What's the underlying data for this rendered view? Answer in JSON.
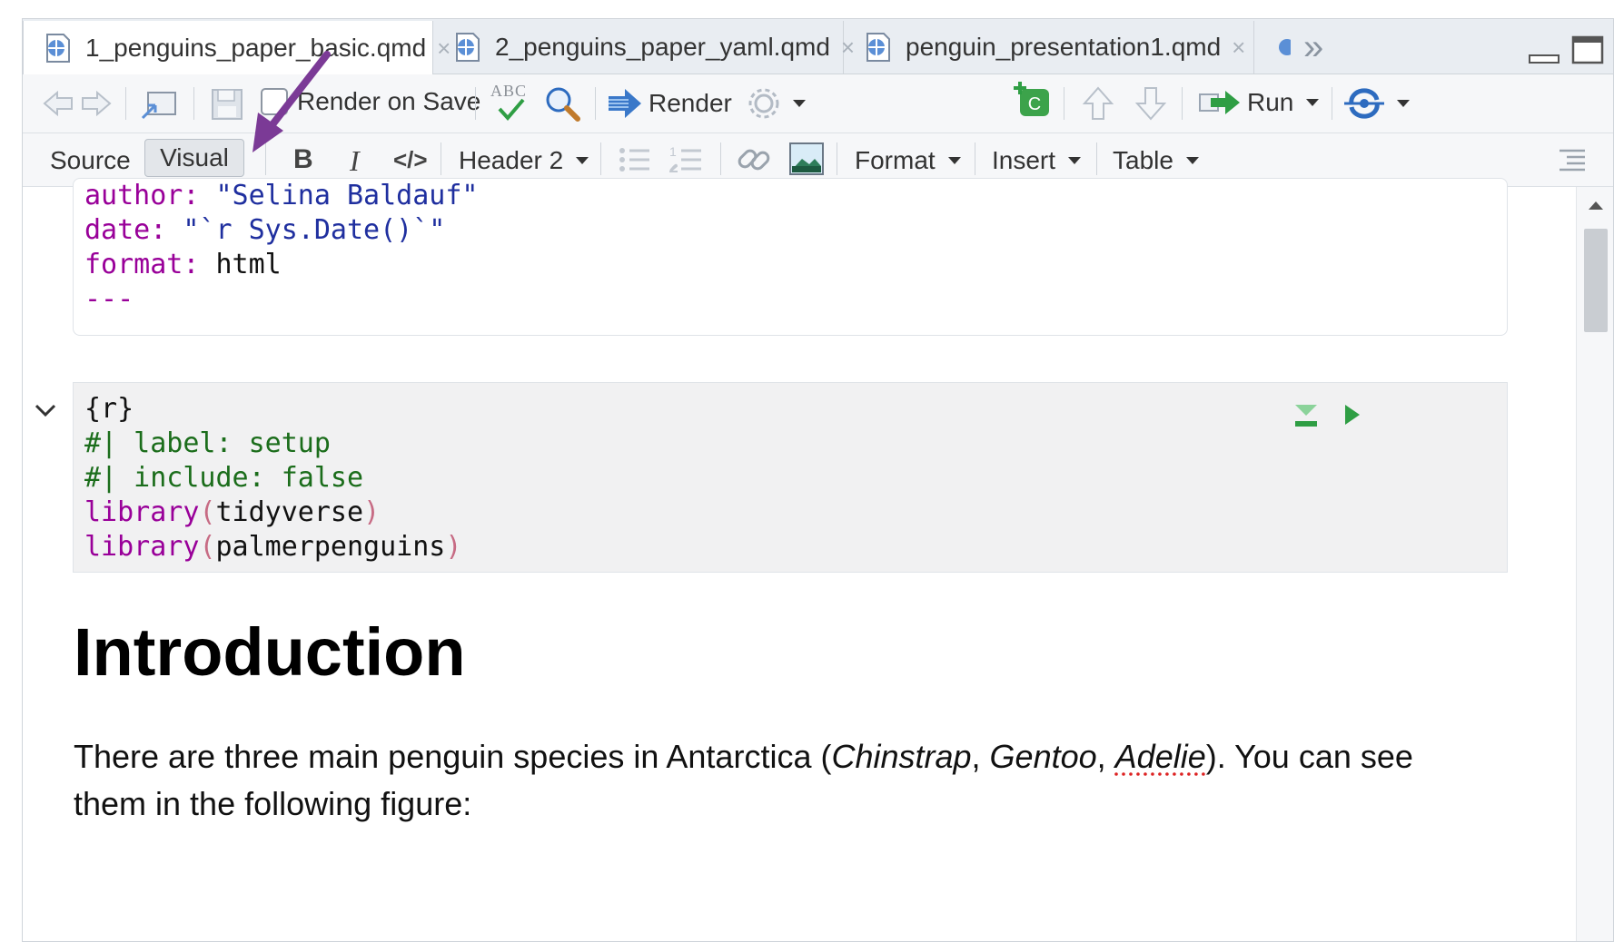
{
  "tabs": [
    {
      "label": "1_penguins_paper_basic.qmd",
      "active": true
    },
    {
      "label": "2_penguins_paper_yaml.qmd",
      "active": false
    },
    {
      "label": "penguin_presentation1.qmd",
      "active": false
    }
  ],
  "tab_overflow": "»",
  "tab_close": "×",
  "toolbar": {
    "render_on_save_label": "Render on Save",
    "spell_label": "ABC",
    "render_label": "Render",
    "run_label": "Run"
  },
  "format_toolbar": {
    "source_label": "Source",
    "visual_label": "Visual",
    "bold_label": "B",
    "italic_label": "I",
    "code_label": "</>",
    "header_label": "Header 2",
    "list_num_label": "1",
    "format_label": "Format",
    "insert_label": "Insert",
    "table_label": "Table"
  },
  "yaml": {
    "line1_key": "author:",
    "line1_val": "\"Selina Baldauf\"",
    "line2_key": "date:",
    "line2_val": "\"`r Sys.Date()`\"",
    "line3_key": "format:",
    "line3_val": "html",
    "line4": "---"
  },
  "chunk": {
    "header": "{r}",
    "line1": "#| label: setup",
    "line2": "#| include: false",
    "line3_fn": "library",
    "line3_arg": "tidyverse",
    "line4_fn": "library",
    "line4_arg": "palmerpenguins",
    "paren_open": "(",
    "paren_close": ")"
  },
  "doc": {
    "heading": "Introduction",
    "para_start": "There are three main penguin species in Antarctica (",
    "species1": "Chinstrap",
    "comma1": ", ",
    "species2": "Gentoo",
    "comma2": ", ",
    "species3": "Adelie",
    "para_end": "). You can see them in the following figure:"
  },
  "colors": {
    "annotation_arrow": "#7b3a96",
    "run_green": "#2f9e44",
    "render_blue": "#3a78c9"
  }
}
